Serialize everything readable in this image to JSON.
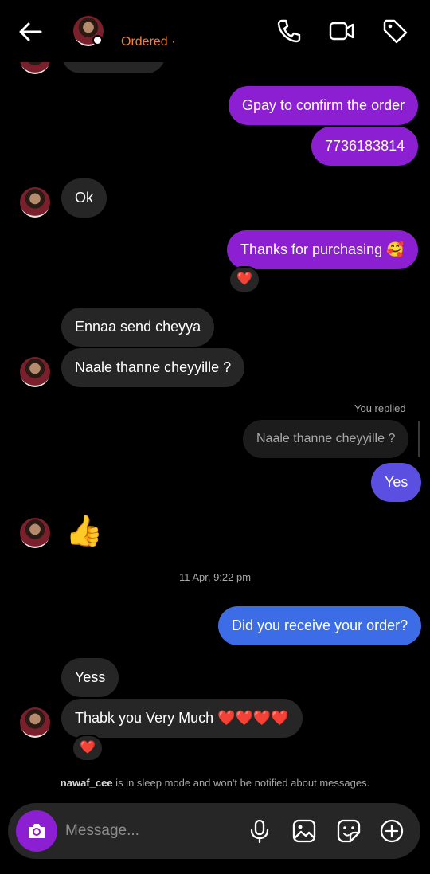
{
  "header": {
    "status": "Ordered ·",
    "icons": [
      "back-arrow-icon",
      "phone-icon",
      "video-camera-icon",
      "tag-icon"
    ]
  },
  "messages": {
    "m1": "Gpay to confirm the order",
    "m2": "7736183814",
    "m3": "Ok",
    "m4": "Thanks for purchasing 🥰",
    "m5": "Ennaa send cheyya",
    "m6": "Naale thanne cheyyille ?",
    "reply_label": "You replied",
    "quoted": "Naale thanne cheyyille ?",
    "m7": "Yes",
    "m8": "👍",
    "timestamp": "11 Apr, 9:22 pm",
    "m9": "Did you receive your order?",
    "m10": "Yess",
    "m11": "Thabk you Very Much ❤️❤️❤️❤️",
    "reaction": "❤️"
  },
  "notice": {
    "username": "nawaf_cee",
    "text": " is in sleep mode and won't be notified about messages."
  },
  "composer": {
    "placeholder": "Message...",
    "icons": [
      "camera-icon",
      "microphone-icon",
      "gallery-icon",
      "sticker-icon",
      "plus-icon"
    ]
  },
  "colors": {
    "outgoing": "#8b1fd1",
    "incoming": "#262626",
    "status": "#f0803c",
    "blue": "#3c6de6"
  }
}
